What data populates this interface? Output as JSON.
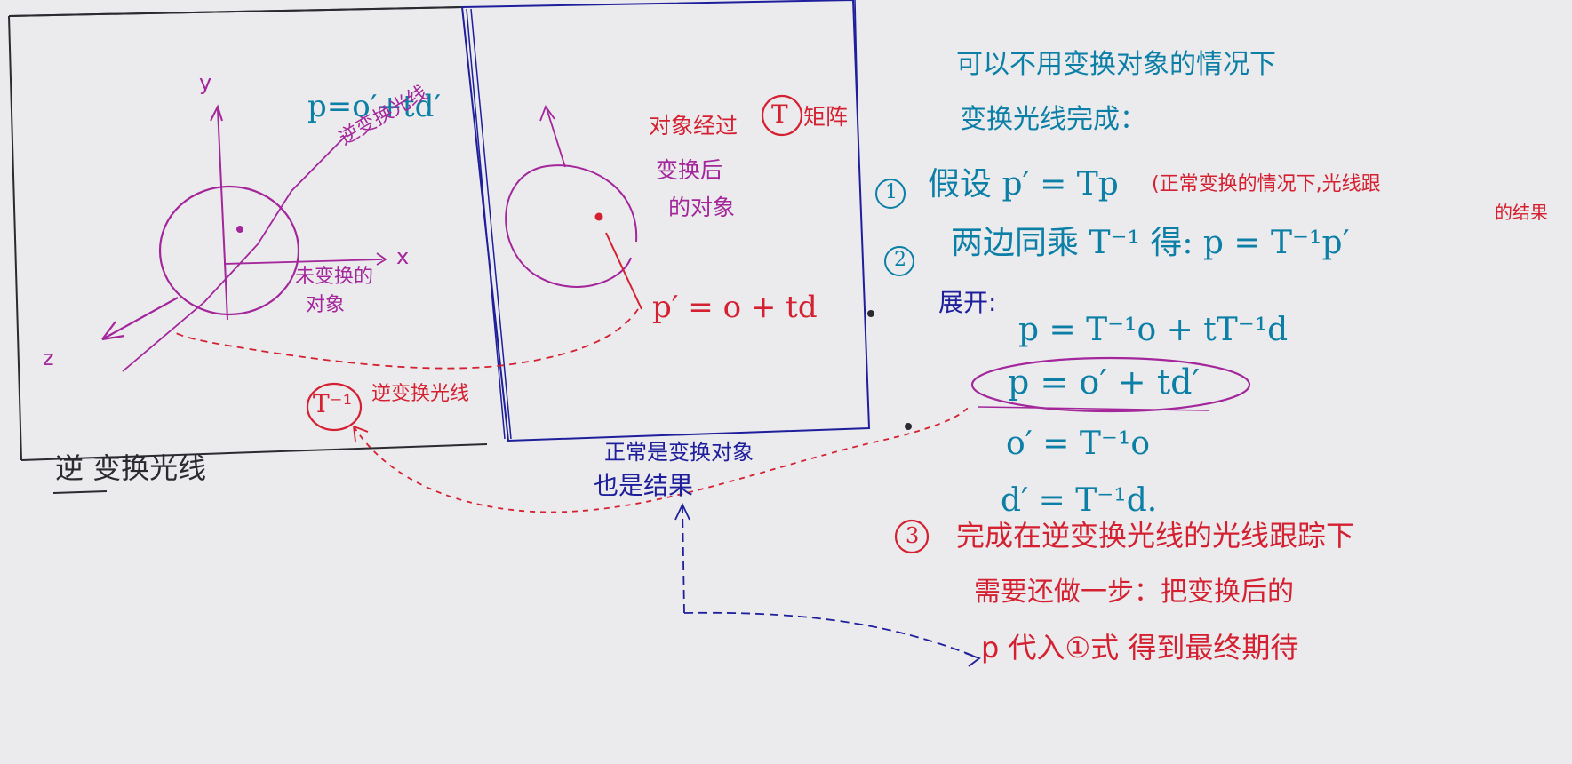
{
  "colors": {
    "paper": "#ebebee",
    "ink_black": "#2a2a30",
    "ink_blue": "#1f1f9c",
    "ink_purple": "#a3269a",
    "ink_teal": "#0c7fa6",
    "ink_red": "#d42030"
  },
  "left_panel": {
    "axis_y": "y",
    "axis_x": "x",
    "axis_z": "z",
    "ray_eq": "p=o′+td′",
    "ray_note": "逆变换光线",
    "object_label_1": "未变换的",
    "object_label_2": "对象",
    "inverse_symbol": "T⁻¹",
    "inverse_note": "逆变换光线",
    "caption": "逆 变换光线"
  },
  "middle_panel": {
    "note_1a": "对象经过",
    "matrix_symbol": "T",
    "note_1b": "矩阵",
    "note_2": "变换后",
    "note_3": "的对象",
    "ray_eq": "p′ = o + td",
    "bottom_note_1": "正常是变换对象",
    "bottom_note_2": "也是结果"
  },
  "right_notes": {
    "intro_1": "可以不用变换对象的情况下",
    "intro_2": "变换光线完成：",
    "step1_num": "①",
    "step1_text": "假设  p′ = Tp",
    "step1_note_1": "(正常变换的情况下,光线跟",
    "step1_note_2": "的结果",
    "step2_num": "②",
    "step2_text": "两边同乘 T⁻¹ 得:  p = T⁻¹p′",
    "expand_label": "展开:",
    "eq_1": "p = T⁻¹o + tT⁻¹d",
    "eq_2": "p = o′ + td′",
    "eq_3": "o′ = T⁻¹o",
    "eq_4": "d′ = T⁻¹d.",
    "step3_num": "③",
    "step3_line_1": "完成在逆变换光线的光线跟踪下",
    "step3_line_2": "需要还做一步：把变换后的",
    "step3_line_3": "p 代入①式 得到最终期待"
  }
}
